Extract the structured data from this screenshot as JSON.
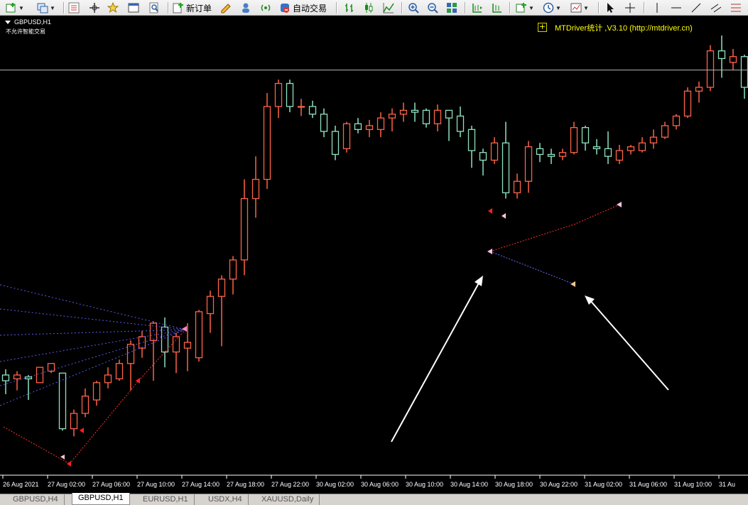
{
  "toolbar": {
    "new_order_label": "新订单",
    "autotrade_label": "自动交易"
  },
  "chart_header": {
    "symbol": "GBPUSD,H1",
    "autotrade_note": "不允许智能交易",
    "ea_label": "MTDriver统计 ,V3.10 (http://mtdriver.cn)"
  },
  "time_axis": {
    "labels": [
      "26 Aug 2021",
      "27 Aug 02:00",
      "27 Aug 06:00",
      "27 Aug 10:00",
      "27 Aug 14:00",
      "27 Aug 18:00",
      "27 Aug 22:00",
      "30 Aug 02:00",
      "30 Aug 06:00",
      "30 Aug 10:00",
      "30 Aug 14:00",
      "30 Aug 18:00",
      "30 Aug 22:00",
      "31 Aug 02:00",
      "31 Aug 06:00",
      "31 Aug 10:00",
      "31 Au"
    ]
  },
  "tabs": [
    {
      "label": "GBPUSD,H4",
      "active": false
    },
    {
      "label": "GBPUSD,H1",
      "active": true
    },
    {
      "label": "EURUSD,H1",
      "active": false
    },
    {
      "label": "USDX,H4",
      "active": false
    },
    {
      "label": "XAUUSD,Daily",
      "active": false
    }
  ],
  "colors": {
    "bull_candle": "#ff6347",
    "bear_candle": "#8ee2c0",
    "background": "#000000",
    "horizontal_line": "#c0c0c0",
    "trade_line_red": "#ff3030",
    "trade_line_blue": "#6a6aff",
    "annotation_arrow": "#ffffff",
    "ea_label": "#ffff00"
  },
  "chart_data": {
    "type": "candlestick",
    "symbol": "GBPUSD",
    "timeframe": "H1",
    "candles": [
      {
        "o": 1.3748,
        "h": 1.3751,
        "l": 1.3738,
        "c": 1.3745
      },
      {
        "o": 1.3746,
        "h": 1.375,
        "l": 1.374,
        "c": 1.3748
      },
      {
        "o": 1.3747,
        "h": 1.3748,
        "l": 1.3735,
        "c": 1.3746
      },
      {
        "o": 1.3744,
        "h": 1.3752,
        "l": 1.3744,
        "c": 1.3752
      },
      {
        "o": 1.375,
        "h": 1.3754,
        "l": 1.3749,
        "c": 1.3754
      },
      {
        "o": 1.3749,
        "h": 1.3749,
        "l": 1.3719,
        "c": 1.372
      },
      {
        "o": 1.372,
        "h": 1.373,
        "l": 1.3716,
        "c": 1.3728
      },
      {
        "o": 1.3728,
        "h": 1.3741,
        "l": 1.3726,
        "c": 1.3737
      },
      {
        "o": 1.3735,
        "h": 1.3745,
        "l": 1.3732,
        "c": 1.3744
      },
      {
        "o": 1.3744,
        "h": 1.3752,
        "l": 1.3741,
        "c": 1.3748
      },
      {
        "o": 1.3746,
        "h": 1.3756,
        "l": 1.3745,
        "c": 1.3754
      },
      {
        "o": 1.3754,
        "h": 1.3766,
        "l": 1.374,
        "c": 1.3764
      },
      {
        "o": 1.3762,
        "h": 1.3771,
        "l": 1.3757,
        "c": 1.3768
      },
      {
        "o": 1.3766,
        "h": 1.3776,
        "l": 1.3745,
        "c": 1.3775
      },
      {
        "o": 1.3773,
        "h": 1.3778,
        "l": 1.3752,
        "c": 1.376
      },
      {
        "o": 1.376,
        "h": 1.377,
        "l": 1.3749,
        "c": 1.3768
      },
      {
        "o": 1.3762,
        "h": 1.3775,
        "l": 1.375,
        "c": 1.3765
      },
      {
        "o": 1.3757,
        "h": 1.3782,
        "l": 1.3755,
        "c": 1.3781
      },
      {
        "o": 1.378,
        "h": 1.3792,
        "l": 1.377,
        "c": 1.3789
      },
      {
        "o": 1.3789,
        "h": 1.38,
        "l": 1.3763,
        "c": 1.3798
      },
      {
        "o": 1.3798,
        "h": 1.381,
        "l": 1.379,
        "c": 1.3808
      },
      {
        "o": 1.3808,
        "h": 1.385,
        "l": 1.38,
        "c": 1.384
      },
      {
        "o": 1.384,
        "h": 1.3862,
        "l": 1.383,
        "c": 1.385
      },
      {
        "o": 1.385,
        "h": 1.3895,
        "l": 1.3845,
        "c": 1.3888
      },
      {
        "o": 1.3888,
        "h": 1.3902,
        "l": 1.3882,
        "c": 1.39
      },
      {
        "o": 1.39,
        "h": 1.3902,
        "l": 1.3885,
        "c": 1.3888
      },
      {
        "o": 1.3888,
        "h": 1.3892,
        "l": 1.3883,
        "c": 1.3888
      },
      {
        "o": 1.3888,
        "h": 1.3891,
        "l": 1.3882,
        "c": 1.3884
      },
      {
        "o": 1.3884,
        "h": 1.3887,
        "l": 1.3872,
        "c": 1.3875
      },
      {
        "o": 1.3875,
        "h": 1.3878,
        "l": 1.386,
        "c": 1.3863
      },
      {
        "o": 1.3866,
        "h": 1.388,
        "l": 1.3864,
        "c": 1.3879
      },
      {
        "o": 1.3879,
        "h": 1.3882,
        "l": 1.3874,
        "c": 1.3876
      },
      {
        "o": 1.3876,
        "h": 1.3881,
        "l": 1.3872,
        "c": 1.3878
      },
      {
        "o": 1.3876,
        "h": 1.3885,
        "l": 1.3872,
        "c": 1.3882
      },
      {
        "o": 1.3882,
        "h": 1.3887,
        "l": 1.3875,
        "c": 1.3884
      },
      {
        "o": 1.3884,
        "h": 1.389,
        "l": 1.388,
        "c": 1.3886
      },
      {
        "o": 1.3886,
        "h": 1.389,
        "l": 1.388,
        "c": 1.3885
      },
      {
        "o": 1.3886,
        "h": 1.3887,
        "l": 1.3877,
        "c": 1.3879
      },
      {
        "o": 1.3879,
        "h": 1.3889,
        "l": 1.3875,
        "c": 1.3886
      },
      {
        "o": 1.3886,
        "h": 1.3886,
        "l": 1.387,
        "c": 1.3882
      },
      {
        "o": 1.3883,
        "h": 1.3888,
        "l": 1.3872,
        "c": 1.3875
      },
      {
        "o": 1.3876,
        "h": 1.3878,
        "l": 1.3856,
        "c": 1.3865
      },
      {
        "o": 1.3864,
        "h": 1.3866,
        "l": 1.3852,
        "c": 1.386
      },
      {
        "o": 1.386,
        "h": 1.3872,
        "l": 1.3858,
        "c": 1.3869
      },
      {
        "o": 1.3869,
        "h": 1.388,
        "l": 1.384,
        "c": 1.3843
      },
      {
        "o": 1.3843,
        "h": 1.3853,
        "l": 1.384,
        "c": 1.3849
      },
      {
        "o": 1.3849,
        "h": 1.387,
        "l": 1.3843,
        "c": 1.3867
      },
      {
        "o": 1.3866,
        "h": 1.3869,
        "l": 1.3859,
        "c": 1.3863
      },
      {
        "o": 1.3863,
        "h": 1.3866,
        "l": 1.3858,
        "c": 1.3862
      },
      {
        "o": 1.3862,
        "h": 1.3866,
        "l": 1.386,
        "c": 1.3864
      },
      {
        "o": 1.3864,
        "h": 1.388,
        "l": 1.3863,
        "c": 1.3877
      },
      {
        "o": 1.3877,
        "h": 1.3878,
        "l": 1.3865,
        "c": 1.3869
      },
      {
        "o": 1.3867,
        "h": 1.3871,
        "l": 1.3863,
        "c": 1.3866
      },
      {
        "o": 1.3866,
        "h": 1.3875,
        "l": 1.3858,
        "c": 1.3862
      },
      {
        "o": 1.386,
        "h": 1.3868,
        "l": 1.3858,
        "c": 1.3865
      },
      {
        "o": 1.3865,
        "h": 1.3868,
        "l": 1.3863,
        "c": 1.3867
      },
      {
        "o": 1.3865,
        "h": 1.3872,
        "l": 1.3864,
        "c": 1.3869
      },
      {
        "o": 1.3869,
        "h": 1.3876,
        "l": 1.3866,
        "c": 1.3872
      },
      {
        "o": 1.3872,
        "h": 1.388,
        "l": 1.3871,
        "c": 1.3878
      },
      {
        "o": 1.3878,
        "h": 1.3884,
        "l": 1.3876,
        "c": 1.3883
      },
      {
        "o": 1.3883,
        "h": 1.3898,
        "l": 1.3882,
        "c": 1.3896
      },
      {
        "o": 1.3896,
        "h": 1.3901,
        "l": 1.389,
        "c": 1.3898
      },
      {
        "o": 1.3898,
        "h": 1.392,
        "l": 1.3896,
        "c": 1.3917
      },
      {
        "o": 1.3917,
        "h": 1.3925,
        "l": 1.3903,
        "c": 1.3913
      },
      {
        "o": 1.3911,
        "h": 1.3918,
        "l": 1.3907,
        "c": 1.3914
      },
      {
        "o": 1.3914,
        "h": 1.3915,
        "l": 1.3892,
        "c": 1.3898
      },
      {
        "o": 1.3898,
        "h": 1.39,
        "l": 1.3887,
        "c": 1.3895
      },
      {
        "o": 1.3895,
        "h": 1.3904,
        "l": 1.389,
        "c": 1.3896
      },
      {
        "o": 1.3896,
        "h": 1.3915,
        "l": 1.3888,
        "c": 1.3908
      },
      {
        "o": 1.3908,
        "h": 1.3913,
        "l": 1.3896,
        "c": 1.3912
      }
    ],
    "horizontal_line_price": 1.3907,
    "ylim": [
      1.3698,
      1.3935
    ]
  }
}
